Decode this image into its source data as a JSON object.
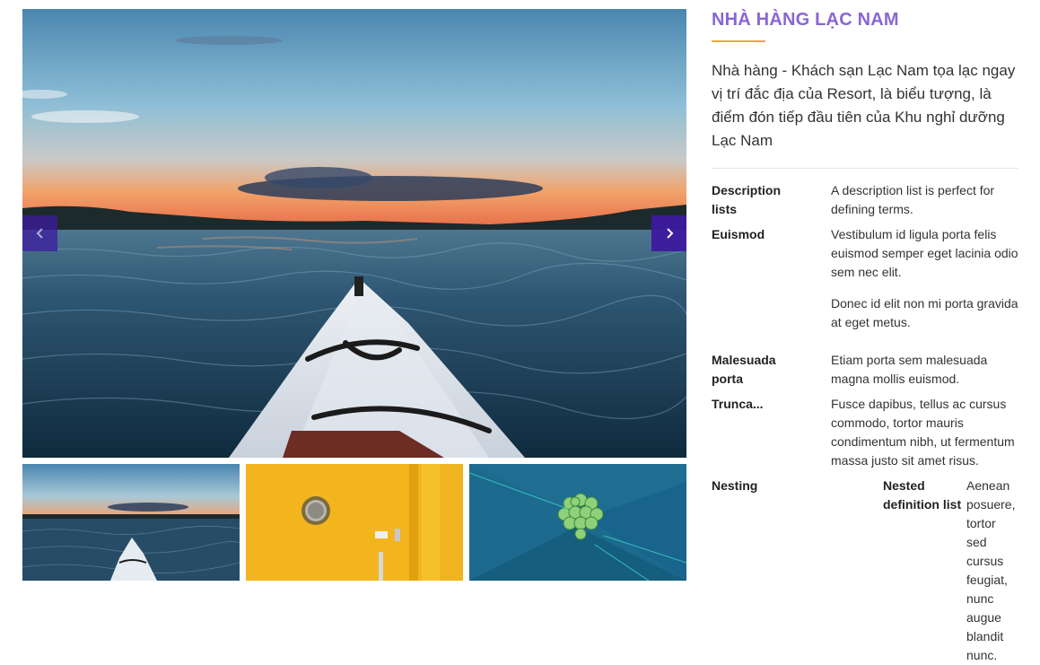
{
  "gallery": {
    "main_image": "kayak-lake-sunset",
    "prev_icon": "chevron-left-icon",
    "next_icon": "chevron-right-icon",
    "thumbnails": [
      {
        "image": "kayak-lake-sunset"
      },
      {
        "image": "yellow-door-porthole"
      },
      {
        "image": "green-flowers-on-blue-tarp"
      }
    ]
  },
  "info": {
    "title": "NHÀ HÀNG LẠC NAM",
    "intro": "Nhà hàng - Khách sạn Lạc Nam tọa lạc ngay vị trí đắc địa của Resort, là biểu tượng, là điểm đón tiếp đầu tiên của Khu nghỉ dưỡng Lạc Nam",
    "definitions": [
      {
        "term": "Description lists",
        "desc": [
          "A description list is perfect for defining terms."
        ]
      },
      {
        "term": "Euismod",
        "desc": [
          "Vestibulum id ligula porta felis euismod semper eget lacinia odio sem nec elit.",
          "Donec id elit non mi porta gravida at eget metus."
        ]
      },
      {
        "term": "Malesuada porta",
        "desc": [
          "Etiam porta sem malesuada magna mollis euismod."
        ]
      },
      {
        "term": "Trunca...",
        "desc": [
          "Fusce dapibus, tellus ac cursus commodo, tortor mauris condimentum nibh, ut fermentum massa justo sit amet risus."
        ]
      },
      {
        "term": "Nesting",
        "nested": {
          "term": "Nested definition list",
          "desc": "Aenean posuere, tortor sed cursus feugiat, nunc augue blandit nunc."
        }
      }
    ]
  },
  "colors": {
    "title": "#8866d4",
    "accent_bar": "#f0a830",
    "nav_button": "#3d1a9e"
  }
}
